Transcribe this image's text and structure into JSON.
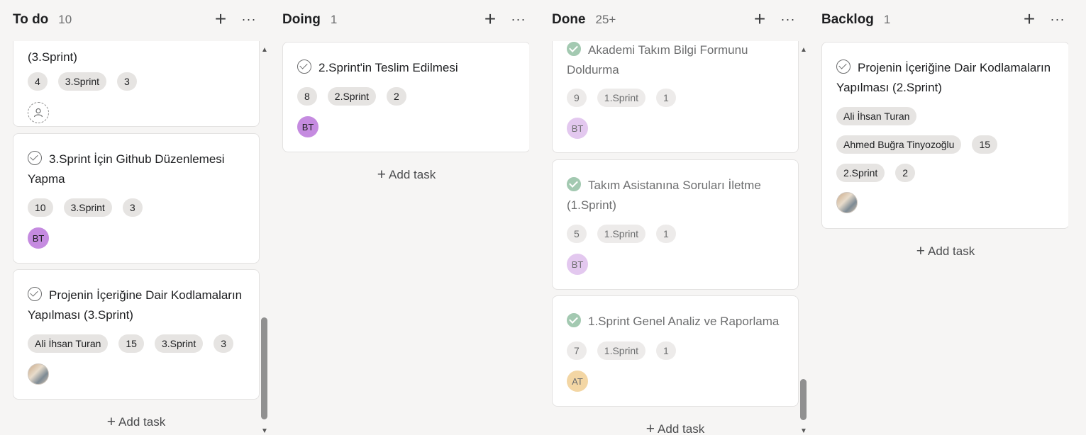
{
  "columns": [
    {
      "title": "To do",
      "count": "10",
      "add_task": "Add task",
      "cards": [
        {
          "title": "(3.Sprint)",
          "pills": [
            "4",
            "3.Sprint",
            "3"
          ],
          "avatar": ""
        },
        {
          "title": "3.Sprint İçin Github Düzenlemesi Yapma",
          "pills": [
            "10",
            "3.Sprint",
            "3"
          ],
          "avatar": "BT"
        },
        {
          "title": "Projenin İçeriğine Dair Kodlamaların Yapılması (3.Sprint)",
          "pills": [
            "Ali İhsan Turan",
            "15",
            "3.Sprint",
            "3"
          ],
          "avatar": ""
        }
      ]
    },
    {
      "title": "Doing",
      "count": "1",
      "add_task": "Add task",
      "cards": [
        {
          "title": "2.Sprint'in Teslim Edilmesi",
          "pills": [
            "8",
            "2.Sprint",
            "2"
          ],
          "avatar": "BT"
        }
      ]
    },
    {
      "title": "Done",
      "count": "25+",
      "add_task": "Add task",
      "cards": [
        {
          "title": "Akademi Takım Bilgi Formunu Doldurma",
          "pills": [
            "9",
            "1.Sprint",
            "1"
          ],
          "avatar": "BT"
        },
        {
          "title": "Takım Asistanına Soruları İletme (1.Sprint)",
          "pills": [
            "5",
            "1.Sprint",
            "1"
          ],
          "avatar": "BT"
        },
        {
          "title": "1.Sprint Genel Analiz ve Raporlama",
          "pills": [
            "7",
            "1.Sprint",
            "1"
          ],
          "avatar": "AT"
        }
      ]
    },
    {
      "title": "Backlog",
      "count": "1",
      "add_task": "Add task",
      "cards": [
        {
          "title": "Projenin İçeriğine Dair Kodlamaların Yapılması (2.Sprint)",
          "pills_row1": [
            "Ali İhsan Turan"
          ],
          "pills_row2": [
            "Ahmed Buğra Tinyozoğlu",
            "15"
          ],
          "pills_row3": [
            "2.Sprint",
            "2"
          ],
          "avatar": ""
        }
      ]
    }
  ],
  "icons": {
    "add": "plus-icon",
    "more": "more-horizontal-icon",
    "complete": "check-circle-icon",
    "scroll_up": "triangle-up-icon",
    "scroll_down": "triangle-down-icon"
  },
  "glyphs": {
    "plus": "+",
    "more": "···",
    "up": "▲",
    "down": "▼"
  },
  "colors": {
    "background": "#f6f5f4",
    "card": "#ffffff",
    "pill": "#e6e4e2",
    "avatar_bt": "#c58be0",
    "avatar_at": "#f3d6a4",
    "done_check": "#a3c9b1"
  }
}
